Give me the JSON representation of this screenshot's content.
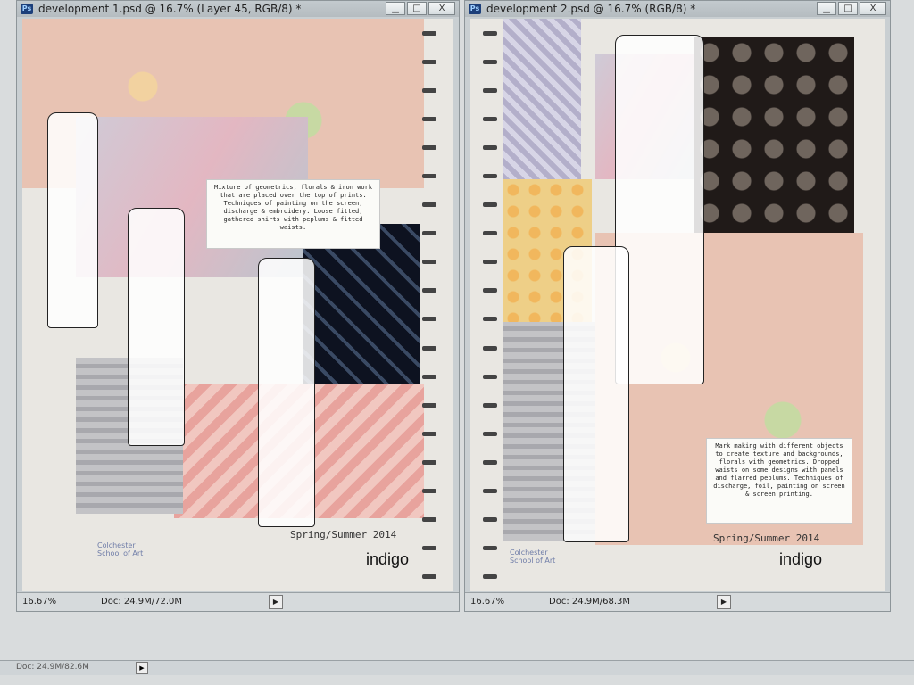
{
  "windows": [
    {
      "title": "development 1.psd @ 16.7% (Layer 45, RGB/8) *",
      "zoom": "16.67%",
      "doc": "Doc: 24.9M/72.0M",
      "text": "Mixture of geometrics, florals & iron work that are placed over the top of prints. Techniques of painting on the screen, discharge & embroidery. Loose fitted, gathered shirts with peplums & fitted waists.",
      "season": "Spring/Summer 2014",
      "brand": "indigo",
      "school": "Colchester\nSchool of Art"
    },
    {
      "title": "development 2.psd @ 16.7% (RGB/8) *",
      "zoom": "16.67%",
      "doc": "Doc: 24.9M/68.3M",
      "text": "Mark making with different objects to create texture and backgrounds, florals with geometrics. Dropped waists on some designs with panels and flarred peplums. Techniques of discharge, foil, painting on screen & screen printing.",
      "season": "Spring/Summer 2014",
      "brand": "indigo",
      "school": "Colchester\nSchool of Art"
    }
  ],
  "window_controls": {
    "minimize": "▁",
    "maximize": "□",
    "close": "X"
  },
  "ps_badge": "Ps",
  "bottom_doc": "Doc: 24.9M/82.6M",
  "arrow": "▶",
  "icons": {
    "app": "photoshop-icon",
    "arrow": "triangle-right-icon"
  }
}
